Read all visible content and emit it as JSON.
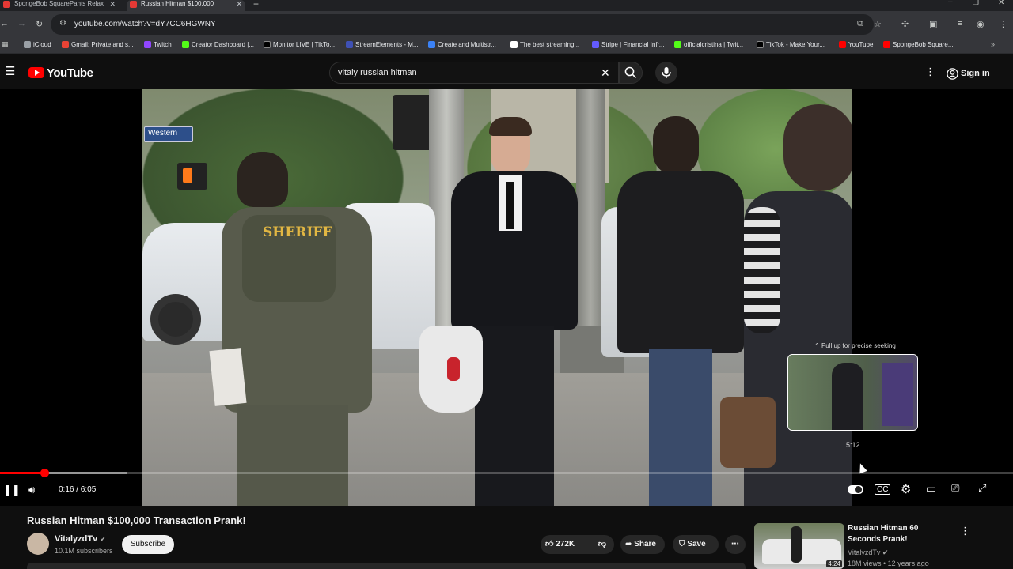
{
  "browser": {
    "tabs": [
      {
        "title": "SpongeBob SquarePants Relax"
      },
      {
        "title": "Russian Hitman $100,000"
      }
    ],
    "url": "youtube.com/watch?v=dY7CC6HGWNY",
    "bookmarks": [
      {
        "label": "iCloud",
        "color": "#9aa0a6"
      },
      {
        "label": "Gmail: Private and s...",
        "color": "#ea4335"
      },
      {
        "label": "Twitch",
        "color": "#9146ff"
      },
      {
        "label": "Creator Dashboard |...",
        "color": "#53fc18"
      },
      {
        "label": "Monitor LIVE | TikTo...",
        "color": "#000000"
      },
      {
        "label": "StreamElements - M...",
        "color": "#3f51b5"
      },
      {
        "label": "Create and Multistr...",
        "color": "#3b82f6"
      },
      {
        "label": "The best streaming...",
        "color": "#ffffff"
      },
      {
        "label": "Stripe | Financial Infr...",
        "color": "#635bff"
      },
      {
        "label": "officialcristina | Twit...",
        "color": "#53fc18"
      },
      {
        "label": "TikTok - Make Your...",
        "color": "#000000"
      },
      {
        "label": "YouTube",
        "color": "#ff0000"
      },
      {
        "label": "SpongeBob Square...",
        "color": "#ff0000"
      }
    ]
  },
  "youtube": {
    "logo_text": "YouTube",
    "search_value": "vitaly russian hitman",
    "sign_in": "Sign in"
  },
  "player": {
    "time": "0:16 / 6:05",
    "progress_fraction": 0.0438,
    "buffered_fraction": 0.126,
    "pull_up_hint": "Pull up for precise seeking",
    "preview_time": "5:12",
    "scene_sign": "Western",
    "scene_badge": "SHERIFF"
  },
  "video": {
    "title": "Russian Hitman $100,000 Transaction Prank!",
    "channel": "VitalyzdTv",
    "subscribers": "10.1M subscribers",
    "subscribe_label": "Subscribe",
    "likes": "272K",
    "share_label": "Share",
    "save_label": "Save"
  },
  "recommended": {
    "title": "Russian Hitman 60 Seconds Prank!",
    "channel": "VitalyzdTv",
    "meta": "18M views • 12 years ago",
    "duration": "4:24"
  }
}
